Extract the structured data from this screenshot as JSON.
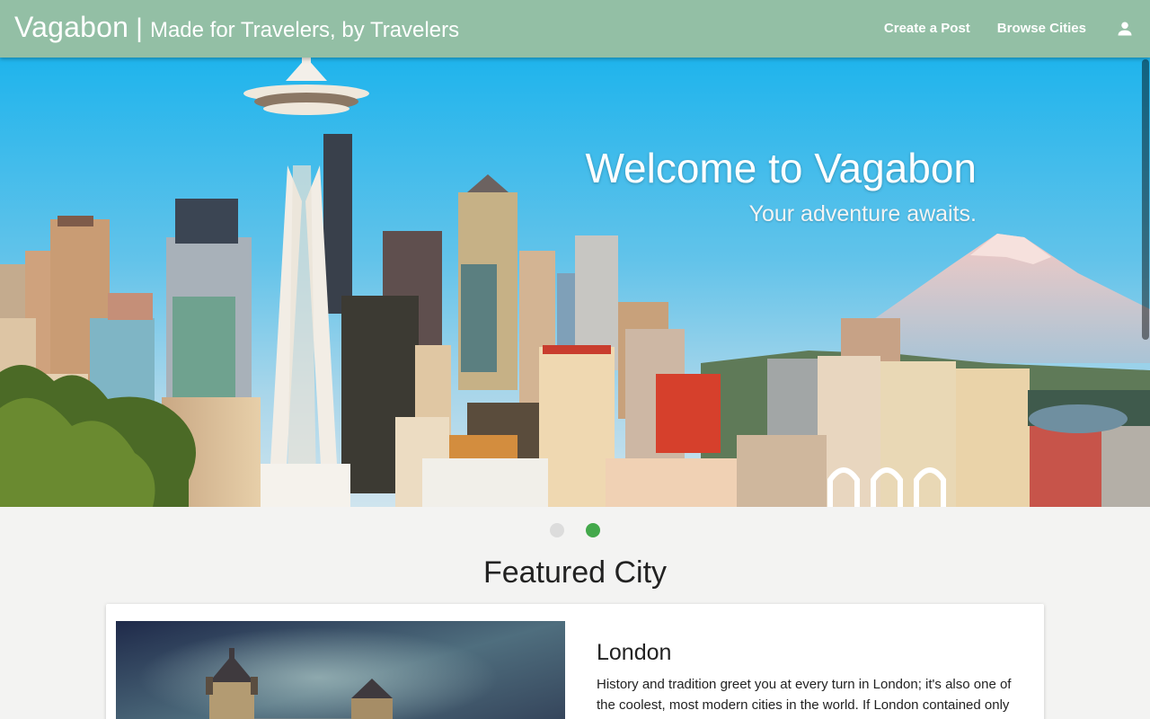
{
  "navbar": {
    "brand_name": "Vagabon",
    "separator": "|",
    "tagline": "Made for Travelers, by Travelers",
    "links": [
      "Create a Post",
      "Browse Cities"
    ],
    "user_icon": "person-icon",
    "background": "#93bfa5"
  },
  "hero": {
    "title": "Welcome to Vagabon",
    "subtitle": "Your adventure awaits."
  },
  "carousel": {
    "dot_count": 2,
    "active_index": 1,
    "active_color": "#43a84b"
  },
  "featured": {
    "heading": "Featured City",
    "city": {
      "name": "London",
      "description": "History and tradition greet you at every turn in London; it's also one of the coolest, most modern cities in the world. If London contained only"
    }
  }
}
